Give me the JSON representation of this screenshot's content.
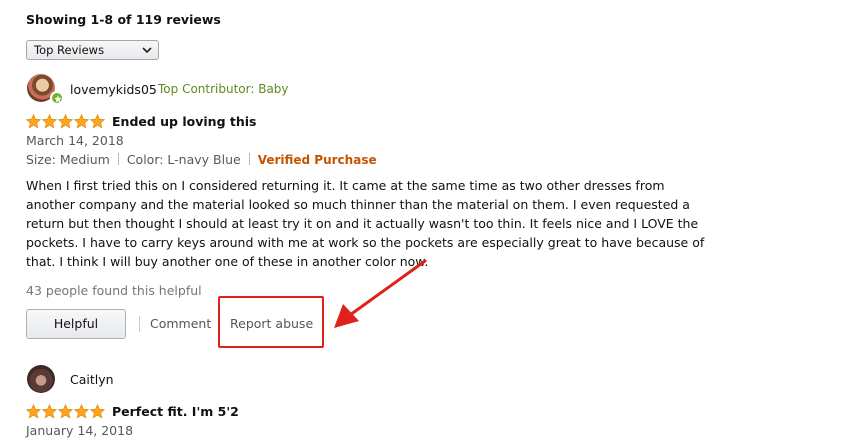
{
  "summary": "Showing 1-8 of 119 reviews",
  "sort": {
    "selected": "Top Reviews",
    "icon": "chevron-down-icon"
  },
  "colors": {
    "verified": "#c45500",
    "contributor": "#5f8a1f",
    "star": "#ffa41c",
    "highlight": "#e0201b"
  },
  "reviews": [
    {
      "username": "lovemykids05",
      "badge": "Top Contributor: Baby",
      "rating": 5,
      "title": "Ended up loving this",
      "date": "March 14, 2018",
      "size": "Size: Medium",
      "color": "Color: L-navy Blue",
      "verified": "Verified Purchase",
      "body": "When I first tried this on I considered returning it. It came at the same time as two other dresses from another company and the material looked so much thinner than the material on them. I even requested a return but then thought I should at least try it on and it actually wasn't too thin. It feels nice and I LOVE the pockets. I have to carry keys around with me at work so the pockets are especially great to have because of that. I think I will buy another one of these in another color now.",
      "helpful_count": "43 people found this helpful",
      "actions": {
        "helpful": "Helpful",
        "comment": "Comment",
        "report": "Report abuse"
      }
    },
    {
      "username": "Caitlyn",
      "rating": 5,
      "title": "Perfect fit. I'm 5'2",
      "date": "January 14, 2018"
    }
  ]
}
